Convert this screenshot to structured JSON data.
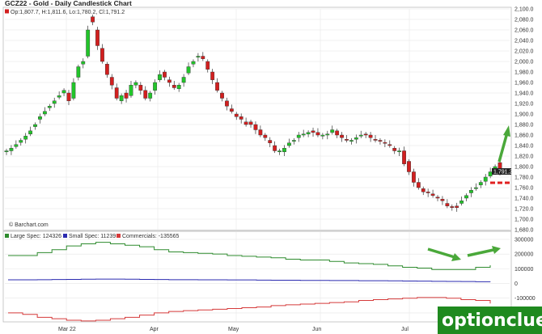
{
  "title": "GCZ22 - Gold - Daily Candlestick Chart",
  "ohlc_label": "Op:1,807.7, H:1,811.6, Lo:1,780.2, Cl:1,791.2",
  "barchart_credit": "© Barchart.com",
  "last_price_label": "1,791.2",
  "cot_legend": {
    "large_spec": "Large Spec: 124326",
    "small_spec": "Small Spec: 11239",
    "commercials": "Commercials: -135565"
  },
  "watermark": "optionclue.com",
  "colors": {
    "up": "#22c52a",
    "down": "#d21f1f",
    "large_spec": "#2e8b2e",
    "small_spec": "#2b2bb0",
    "commercials": "#d53a3a",
    "arrow": "#4aa83a",
    "watermark_bg": "#1f8a1f"
  },
  "chart_data": [
    {
      "type": "candlestick",
      "title": "GCZ22 - Gold - Daily Candlestick Chart",
      "ylim": [
        1680,
        2100
      ],
      "y_ticks": [
        "2,100.0",
        "2,080.0",
        "2,060.0",
        "2,040.0",
        "2,020.0",
        "2,000.0",
        "1,980.0",
        "1,960.0",
        "1,940.0",
        "1,920.0",
        "1,900.0",
        "1,880.0",
        "1,860.0",
        "1,840.0",
        "1,820.0",
        "1,800.0",
        "1,780.0",
        "1,760.0",
        "1,740.0",
        "1,720.0",
        "1,700.0",
        "1,680.0"
      ],
      "x_labels": [
        "Mar 22",
        "Apr",
        "May",
        "Jun",
        "Jul"
      ],
      "last": {
        "open": 1807.7,
        "high": 1811.6,
        "low": 1780.2,
        "close": 1791.2
      },
      "close_path": [
        1830,
        1835,
        1842,
        1850,
        1858,
        1868,
        1880,
        1895,
        1905,
        1915,
        1925,
        1935,
        1945,
        1925,
        1960,
        1990,
        2000,
        2060,
        2075,
        2030,
        2000,
        1975,
        1955,
        1930,
        1935,
        1930,
        1955,
        1960,
        1945,
        1930,
        1940,
        1960,
        1975,
        1970,
        1960,
        1950,
        1955,
        1970,
        1990,
        2000,
        2010,
        2005,
        1985,
        1965,
        1945,
        1930,
        1915,
        1905,
        1895,
        1890,
        1880,
        1880,
        1870,
        1860,
        1855,
        1845,
        1830,
        1830,
        1835,
        1845,
        1850,
        1860,
        1862,
        1865,
        1865,
        1860,
        1860,
        1862,
        1870,
        1860,
        1855,
        1850,
        1850,
        1855,
        1860,
        1860,
        1855,
        1850,
        1848,
        1845,
        1840,
        1830,
        1830,
        1805,
        1790,
        1770,
        1760,
        1752,
        1750,
        1745,
        1740,
        1735,
        1725,
        1722,
        1722,
        1735,
        1745,
        1755,
        1760,
        1770,
        1780,
        1790,
        1800,
        1791
      ],
      "open_path": [
        1828,
        1830,
        1838,
        1846,
        1852,
        1862,
        1876,
        1890,
        1900,
        1912,
        1920,
        1932,
        1940,
        1940,
        1930,
        1970,
        1995,
        2010,
        2085,
        2060,
        2025,
        1995,
        1970,
        1950,
        1925,
        1940,
        1935,
        1955,
        1955,
        1945,
        1930,
        1945,
        1965,
        1980,
        1965,
        1955,
        1948,
        1960,
        1978,
        1995,
        2008,
        2010,
        2000,
        1980,
        1960,
        1940,
        1925,
        1910,
        1900,
        1895,
        1885,
        1885,
        1880,
        1870,
        1860,
        1850,
        1840,
        1828,
        1828,
        1840,
        1848,
        1855,
        1860,
        1862,
        1868,
        1865,
        1858,
        1860,
        1865,
        1868,
        1860,
        1852,
        1848,
        1852,
        1858,
        1862,
        1860,
        1852,
        1850,
        1846,
        1842,
        1835,
        1828,
        1830,
        1810,
        1790,
        1770,
        1758,
        1752,
        1748,
        1742,
        1738,
        1730,
        1724,
        1725,
        1730,
        1740,
        1750,
        1758,
        1765,
        1772,
        1782,
        1795,
        1807.7
      ]
    },
    {
      "type": "line",
      "title": "Commitments of Traders",
      "ylim": [
        -250000,
        300000
      ],
      "y_ticks": [
        "300000",
        "200000",
        "100000",
        "0",
        "-100000",
        "-200000"
      ],
      "series": [
        {
          "name": "Large Spec",
          "values": [
            190000,
            190000,
            210000,
            230000,
            255000,
            270000,
            280000,
            270000,
            260000,
            250000,
            230000,
            215000,
            210000,
            205000,
            200000,
            190000,
            185000,
            180000,
            175000,
            165000,
            160000,
            160000,
            150000,
            140000,
            135000,
            130000,
            120000,
            110000,
            105000,
            95000,
            95000,
            95000,
            110000,
            124326
          ]
        },
        {
          "name": "Small Spec",
          "values": [
            25000,
            25000,
            26000,
            27000,
            28000,
            29000,
            30000,
            30000,
            29000,
            28000,
            27000,
            26000,
            26000,
            25000,
            25000,
            24000,
            24000,
            23000,
            22000,
            22000,
            21000,
            21000,
            20000,
            20000,
            19000,
            19000,
            18000,
            17000,
            16000,
            15000,
            14000,
            13000,
            12000,
            11239
          ]
        },
        {
          "name": "Commercials",
          "values": [
            -200000,
            -210000,
            -230000,
            -240000,
            -250000,
            -255000,
            -250000,
            -240000,
            -230000,
            -215000,
            -200000,
            -190000,
            -185000,
            -180000,
            -175000,
            -170000,
            -165000,
            -160000,
            -150000,
            -145000,
            -140000,
            -135000,
            -130000,
            -125000,
            -115000,
            -110000,
            -105000,
            -100000,
            -95000,
            -95000,
            -100000,
            -110000,
            -115000,
            -135565
          ]
        }
      ]
    }
  ]
}
